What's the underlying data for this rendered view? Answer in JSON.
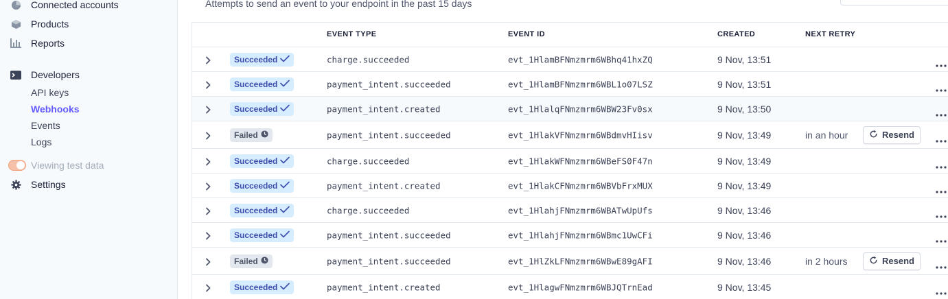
{
  "sidebar": {
    "items_top": [
      {
        "label": "Connected accounts",
        "icon": "connected-accounts-icon"
      },
      {
        "label": "Products",
        "icon": "box-icon"
      },
      {
        "label": "Reports",
        "icon": "reports-icon"
      }
    ],
    "developers": {
      "label": "Developers",
      "icon": "terminal-icon",
      "children": [
        "API keys",
        "Webhooks",
        "Events",
        "Logs"
      ],
      "active": "Webhooks"
    },
    "test_toggle_label": "Viewing test data",
    "settings_label": "Settings"
  },
  "main": {
    "subtitle": "Attempts to send an event to your endpoint in the past 15 days",
    "columns": [
      "EVENT TYPE",
      "EVENT ID",
      "CREATED",
      "NEXT RETRY"
    ],
    "resend_label": "Resend",
    "rows": [
      {
        "status": "Succeeded",
        "type": "charge.succeeded",
        "id": "evt_1HlamBFNmzmrm6WBhq41hxZQ",
        "created": "9 Nov, 13:51",
        "retry": ""
      },
      {
        "status": "Succeeded",
        "type": "payment_intent.succeeded",
        "id": "evt_1HlamBFNmzmrm6WBL1o07LSZ",
        "created": "9 Nov, 13:51",
        "retry": ""
      },
      {
        "status": "Succeeded",
        "type": "payment_intent.created",
        "id": "evt_1HlalqFNmzmrm6WBW23Fv0sx",
        "created": "9 Nov, 13:50",
        "retry": ""
      },
      {
        "status": "Failed",
        "type": "payment_intent.succeeded",
        "id": "evt_1HlakVFNmzmrm6WBdmvHIisv",
        "created": "9 Nov, 13:49",
        "retry": "in an hour"
      },
      {
        "status": "Succeeded",
        "type": "charge.succeeded",
        "id": "evt_1HlakWFNmzmrm6WBeFS0F47n",
        "created": "9 Nov, 13:49",
        "retry": ""
      },
      {
        "status": "Succeeded",
        "type": "payment_intent.created",
        "id": "evt_1HlakCFNmzmrm6WBVbFrxMUX",
        "created": "9 Nov, 13:49",
        "retry": ""
      },
      {
        "status": "Succeeded",
        "type": "charge.succeeded",
        "id": "evt_1HlahjFNmzmrm6WBATwUpUfs",
        "created": "9 Nov, 13:46",
        "retry": ""
      },
      {
        "status": "Succeeded",
        "type": "payment_intent.succeeded",
        "id": "evt_1HlahjFNmzmrm6WBmc1UwCFi",
        "created": "9 Nov, 13:46",
        "retry": ""
      },
      {
        "status": "Failed",
        "type": "payment_intent.succeeded",
        "id": "evt_1HlZkLFNmzmrm6WBwE89gAFI",
        "created": "9 Nov, 13:46",
        "retry": "in 2 hours"
      },
      {
        "status": "Succeeded",
        "type": "payment_intent.created",
        "id": "evt_1HlagwFNmzmrm6WBJQTrnEad",
        "created": "9 Nov, 13:45",
        "retry": ""
      }
    ]
  },
  "colors": {
    "accent": "#635bff",
    "success_bg": "#d6ecff",
    "success_text": "#3d4eac",
    "failed_bg": "#e3e8ee"
  }
}
